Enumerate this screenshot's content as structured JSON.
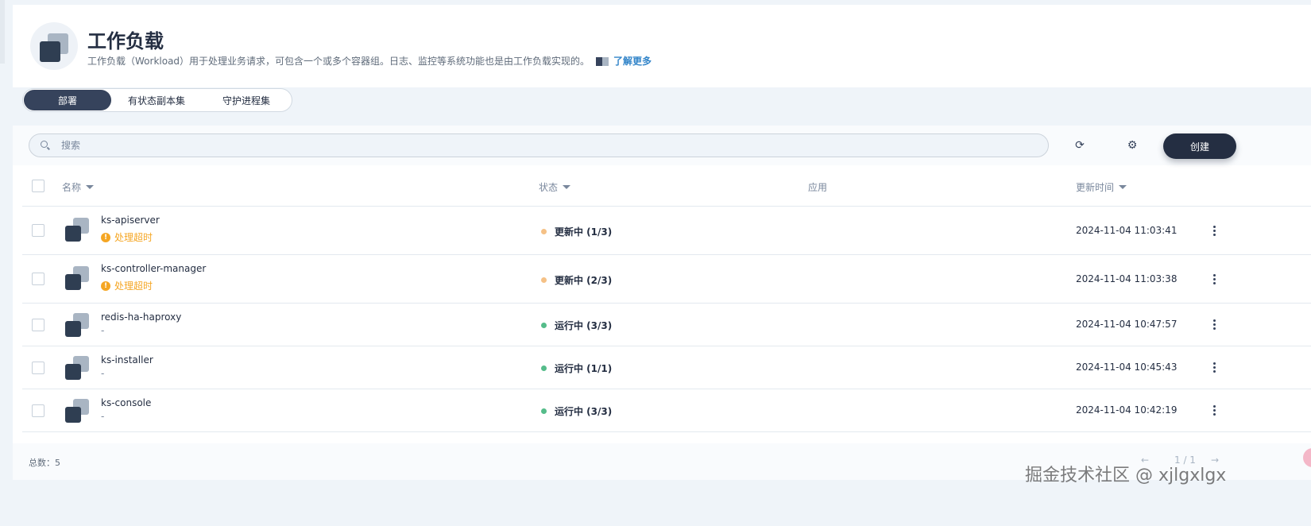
{
  "header": {
    "title": "工作负载",
    "description": "工作负载（Workload）用于处理业务请求，可包含一个或多个容器组。日志、监控等系统功能也是由工作负载实现的。",
    "learn_more": "了解更多"
  },
  "tabs": [
    {
      "label": "部署",
      "active": true
    },
    {
      "label": "有状态副本集",
      "active": false
    },
    {
      "label": "守护进程集",
      "active": false
    }
  ],
  "toolbar": {
    "search_placeholder": "搜索",
    "create_label": "创建"
  },
  "table": {
    "columns": {
      "name": "名称",
      "status": "状态",
      "app": "应用",
      "updated": "更新时间"
    },
    "rows": [
      {
        "name": "ks-apiserver",
        "sub": "处理超时",
        "sub_warn": true,
        "status": "更新中 (1/3)",
        "status_color": "#f5c186",
        "time": "2024-11-04 11:03:41"
      },
      {
        "name": "ks-controller-manager",
        "sub": "处理超时",
        "sub_warn": true,
        "status": "更新中 (2/3)",
        "status_color": "#f5c186",
        "time": "2024-11-04 11:03:38"
      },
      {
        "name": "redis-ha-haproxy",
        "sub": "-",
        "sub_warn": false,
        "status": "运行中 (3/3)",
        "status_color": "#55bc8a",
        "time": "2024-11-04 10:47:57"
      },
      {
        "name": "ks-installer",
        "sub": "-",
        "sub_warn": false,
        "status": "运行中 (1/1)",
        "status_color": "#55bc8a",
        "time": "2024-11-04 10:45:43"
      },
      {
        "name": "ks-console",
        "sub": "-",
        "sub_warn": false,
        "status": "运行中 (3/3)",
        "status_color": "#55bc8a",
        "time": "2024-11-04 10:42:19"
      }
    ]
  },
  "footer": {
    "total": "总数：5",
    "page": "1 / 1",
    "prev": "←",
    "next": "→"
  },
  "watermark": "掘金技术社区 @ xjlgxlgx",
  "icons": {
    "workload": "workload-stack-icon",
    "refresh": "refresh-icon",
    "settings": "gear-icon",
    "more": "more-vertical-icon"
  }
}
